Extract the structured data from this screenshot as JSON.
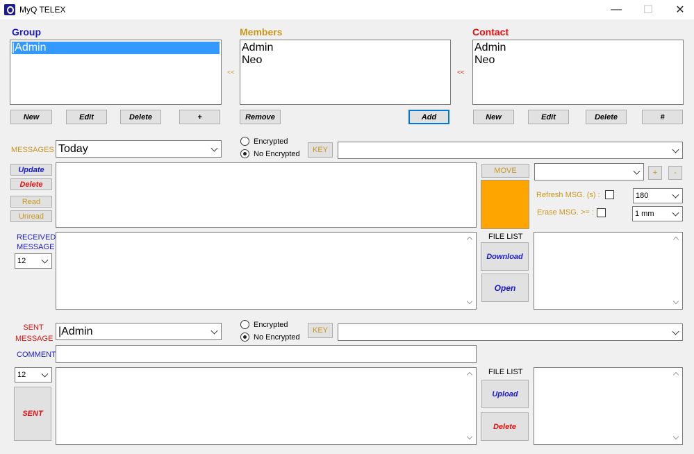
{
  "window": {
    "title": "MyQ TELEX",
    "minimize": "—",
    "maximize": "☐",
    "close": "✕"
  },
  "group": {
    "heading": "Group",
    "items": [
      "|Admin"
    ],
    "buttons": {
      "new": "New",
      "edit": "Edit",
      "delete": "Delete",
      "plus": "+"
    }
  },
  "members": {
    "heading": "Members",
    "items": [
      "Admin",
      "Neo"
    ],
    "buttons": {
      "remove": "Remove",
      "add": "Add"
    },
    "arrow": "<<"
  },
  "contact": {
    "heading": "Contact",
    "items": [
      "Admin",
      "Neo"
    ],
    "buttons": {
      "new": "New",
      "edit": "Edit",
      "delete": "Delete",
      "hash": "#"
    },
    "arrow": "<<"
  },
  "messages": {
    "label": "MESSAGES",
    "filter": "Today",
    "encrypted": "Encrypted",
    "no_encrypted": "No Encrypted",
    "key": "KEY",
    "buttons": {
      "update": "Update",
      "delete": "Delete",
      "read": "Read",
      "unread": "Unread"
    },
    "move": "MOVE",
    "plus": "+",
    "minus": "-",
    "refresh_label": "Refresh MSG. (s) :",
    "refresh_value": "180",
    "erase_label": "Erase MSG. >= :",
    "erase_value": "1 mm",
    "status_color": "#ffa500"
  },
  "received": {
    "label_line1": "RECEIVED",
    "label_line2": "MESSAGE",
    "font_size": "12",
    "file_list": "FILE LIST",
    "download": "Download",
    "open": "Open"
  },
  "sent": {
    "label_line1": "SENT",
    "label_line2": "MESSAGE",
    "recipient": "|Admin",
    "encrypted": "Encrypted",
    "no_encrypted": "No Encrypted",
    "key": "KEY",
    "comment_label": "COMMENT",
    "font_size": "12",
    "send": "SENT",
    "file_list": "FILE LIST",
    "upload": "Upload",
    "delete": "Delete"
  }
}
